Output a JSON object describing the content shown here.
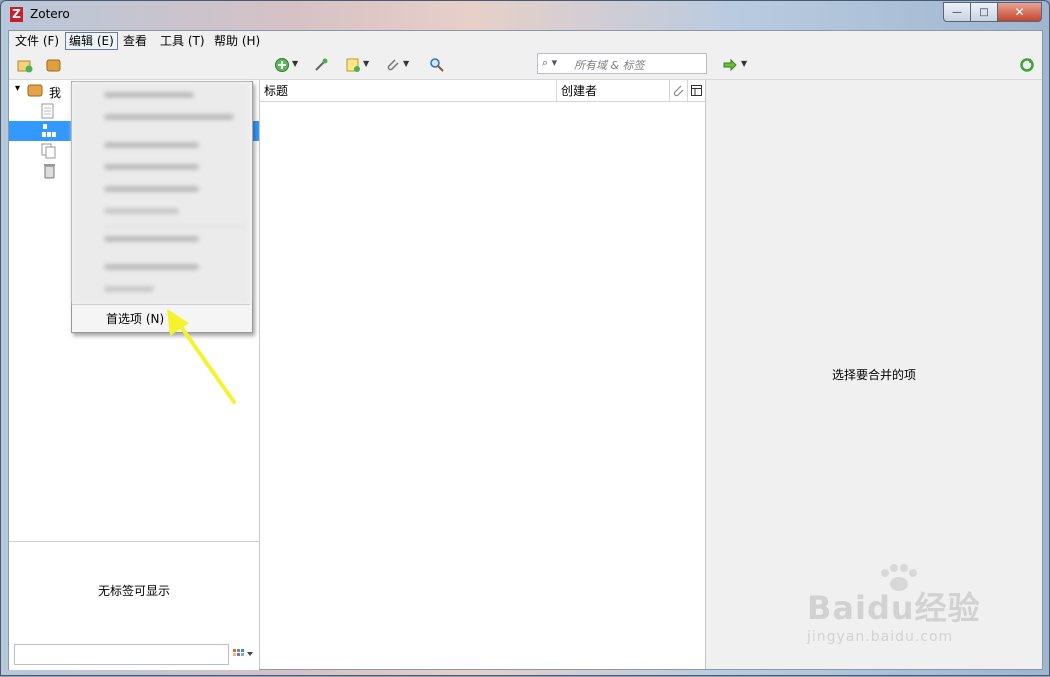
{
  "window": {
    "title": "Zotero",
    "logo_letter": "Z",
    "controls": {
      "minimize": "—",
      "maximize": "□",
      "close": "✕"
    }
  },
  "menubar": {
    "items": [
      "文件 (F)",
      "编辑 (E)",
      "查看",
      "工具 (T)",
      "帮助 (H)"
    ],
    "active_index": 1
  },
  "toolbar": {
    "icons": [
      "new-collection-icon",
      "new-library-icon",
      "new-item-icon",
      "add-by-identifier-icon",
      "new-note-icon",
      "attachment-icon",
      "advanced-search-icon",
      "locate-icon",
      "sync-icon"
    ],
    "search": {
      "placeholder": "所有域 & 标签"
    }
  },
  "collections": {
    "library_label": "我",
    "selected_index": 2
  },
  "edit_menu": {
    "preferences_label": "首选项 (N)"
  },
  "items_list": {
    "columns": [
      "标题",
      "创建者"
    ]
  },
  "tag_selector": {
    "empty_message": "无标签可显示"
  },
  "item_pane": {
    "message": "选择要合并的项"
  },
  "watermark": {
    "brand": "Baidu经验",
    "url": "jingyan.baidu.com"
  },
  "colors": {
    "selection": "#3399ff",
    "annotation_arrow": "#f5f230",
    "zotero_red": "#c8202b"
  }
}
